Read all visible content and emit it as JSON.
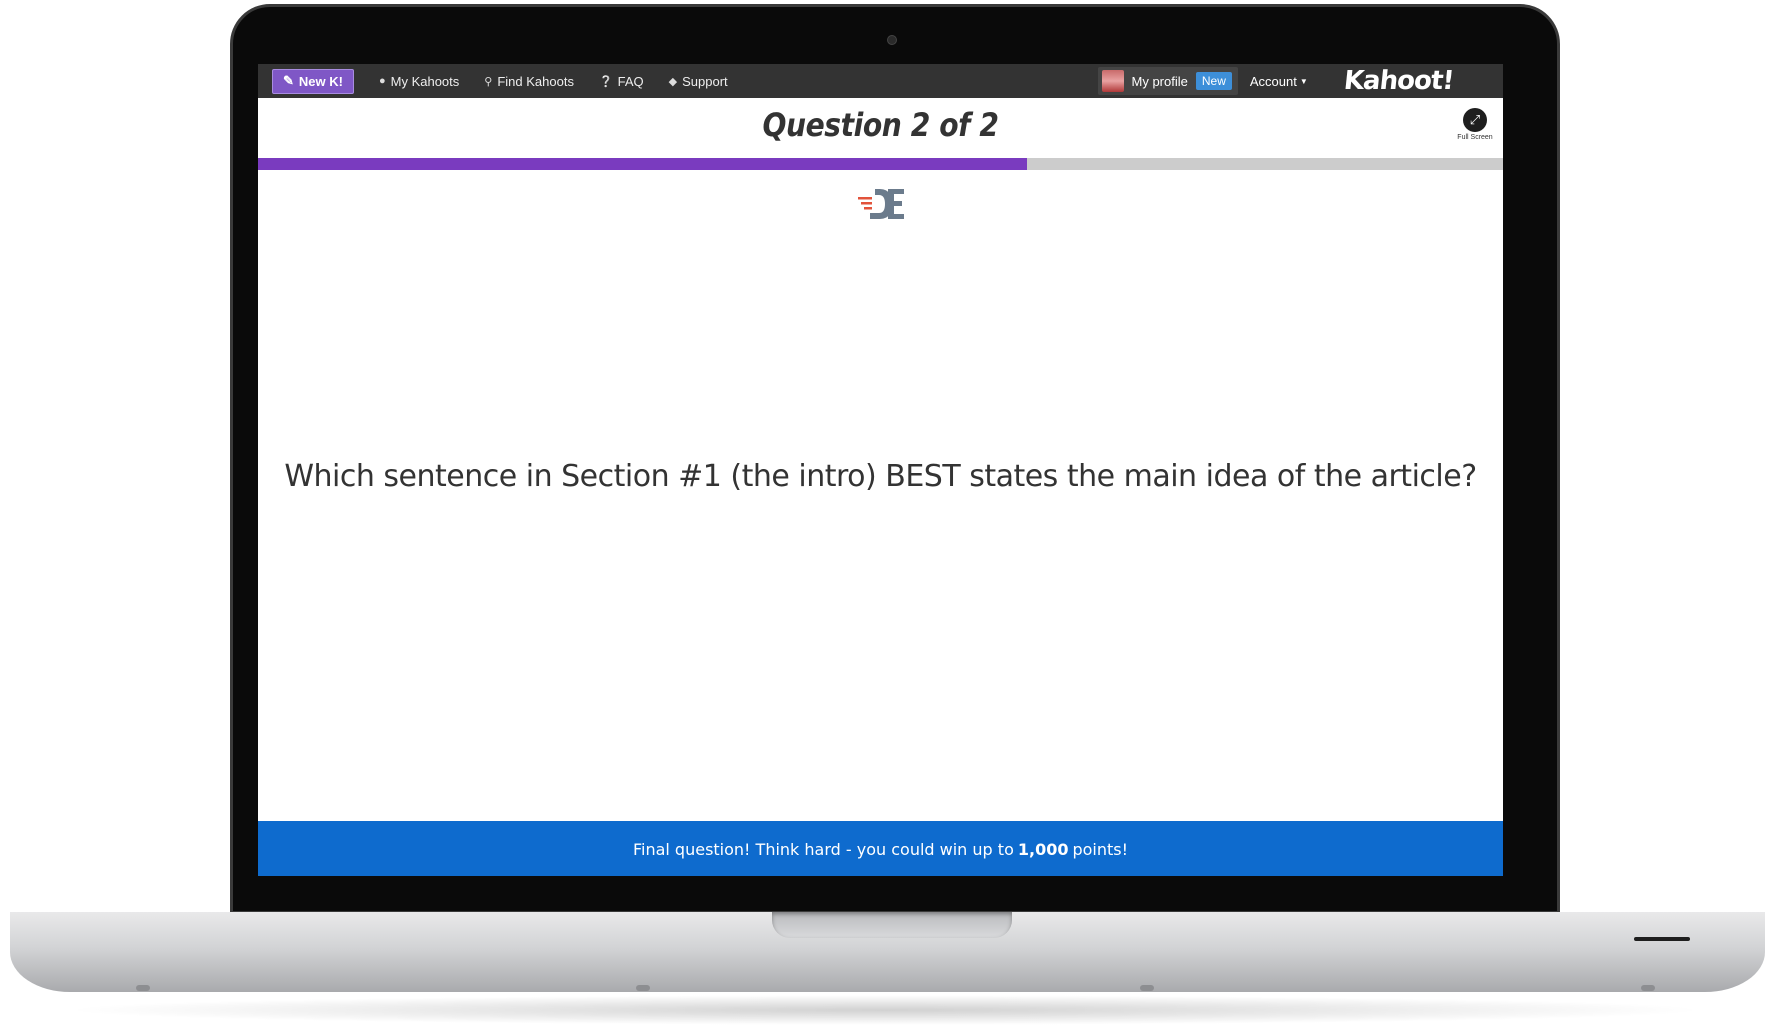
{
  "navbar": {
    "new_k_label": "New K!",
    "links": [
      {
        "label": "My Kahoots",
        "icon": "user-icon"
      },
      {
        "label": "Find Kahoots",
        "icon": "search-icon"
      },
      {
        "label": "FAQ",
        "icon": "question-circle-icon"
      },
      {
        "label": "Support",
        "icon": "chat-bubble-icon"
      }
    ],
    "profile_label": "My profile",
    "new_badge": "New",
    "account_label": "Account",
    "logo_text": "Kahoot!"
  },
  "header": {
    "question_title": "Question 2 of 2",
    "fullscreen_label": "Full Screen"
  },
  "progress": {
    "current": 2,
    "total": 2,
    "fill_fraction": 0.618
  },
  "main": {
    "question_text": "Which sentence in Section #1 (the intro) BEST states the main idea of the article?"
  },
  "footer": {
    "text_before": "Final question! Think hard - you could win up to",
    "points": "1,000",
    "text_after": "points!"
  },
  "colors": {
    "navbar_bg": "#333333",
    "new_k_bg": "#7f57c6",
    "progress_fill": "#7a3bbf",
    "progress_track": "#cccccc",
    "footer_bg": "#0e6bce",
    "badge_bg": "#3d8fd9"
  }
}
